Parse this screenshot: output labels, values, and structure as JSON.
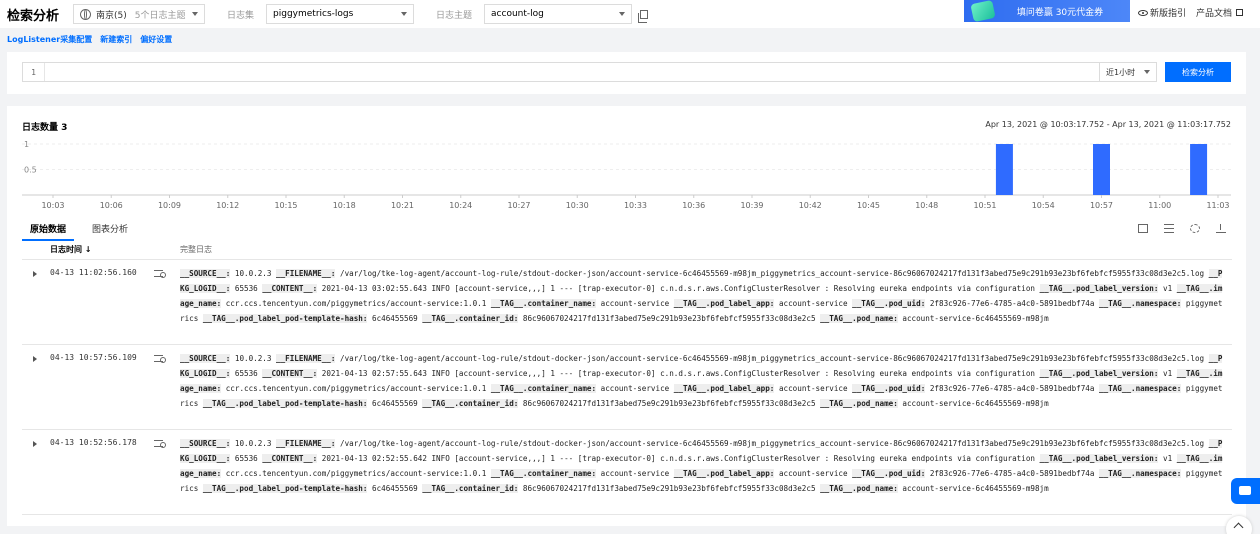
{
  "header": {
    "title": "检索分析",
    "region": "南京(5)",
    "region_sub": "5个日志主题",
    "logset_label": "日志集",
    "logset_value": "piggymetrics-logs",
    "topic_label": "日志主题",
    "topic_value": "account-log",
    "banner": "填问卷赢 30元代金券",
    "guide": "新版指引",
    "docs": "产品文档"
  },
  "links": [
    "LogListener采集配置",
    "新建索引",
    "偏好设置"
  ],
  "search": {
    "line_number": "1",
    "time_range": "近1小时",
    "button": "检索分析"
  },
  "summary": {
    "count_label": "日志数量 3",
    "range": "Apr 13, 2021 @ 10:03:17.752 - Apr 13, 2021 @ 11:03:17.752"
  },
  "chart_data": {
    "type": "bar",
    "ylim": [
      0,
      1
    ],
    "yticks": [
      "1",
      "0.5"
    ],
    "xticks": [
      "10:03",
      "10:06",
      "10:09",
      "10:12",
      "10:15",
      "10:18",
      "10:21",
      "10:24",
      "10:27",
      "10:30",
      "10:33",
      "10:36",
      "10:39",
      "10:42",
      "10:45",
      "10:48",
      "10:51",
      "10:54",
      "10:57",
      "11:00",
      "11:03"
    ],
    "bars": [
      {
        "x": "10:52",
        "value": 1
      },
      {
        "x": "10:57",
        "value": 1
      },
      {
        "x": "11:02",
        "value": 1
      }
    ],
    "color": "#2f6bff"
  },
  "tabs": [
    "原始数据",
    "图表分析"
  ],
  "table": {
    "col_time": "日志时间 ↓",
    "col_log": "完整日志",
    "rows": [
      {
        "time": "04-13 11:02:56.160",
        "parts": [
          {
            "k": "__SOURCE__:",
            "v": " 10.0.2.3 "
          },
          {
            "k": "__FILENAME__:",
            "v": " /var/log/tke-log-agent/account-log-rule/stdout-docker-json/account-service-6c46455569-m98jm_piggymetrics_account-service-86c96067024217fd131f3abed75e9c291b93e23bf6febfcf5955f33c08d3e2c5.log "
          },
          {
            "k": "__PKG_LOGID__:",
            "v": " 65536 "
          },
          {
            "k": "__CONTENT__:",
            "v": " 2021-04-13 03:02:55.643  INFO [account-service,,,] 1 --- [trap-executor-0] c.n.d.s.r.aws.ConfigClusterResolver      : Resolving eureka endpoints via configuration "
          },
          {
            "k": "__TAG__.pod_label_version:",
            "v": " v1 "
          },
          {
            "k": "__TAG__.image_name:",
            "v": " ccr.ccs.tencentyun.com/piggymetrics/account-service:1.0.1 "
          },
          {
            "k": "__TAG__.container_name:",
            "v": " account-service "
          },
          {
            "k": "__TAG__.pod_label_app:",
            "v": " account-service "
          },
          {
            "k": "__TAG__.pod_uid:",
            "v": " 2f83c926-77e6-4785-a4c0-5891bedbf74a "
          },
          {
            "k": "__TAG__.namespace:",
            "v": " piggymetrics "
          },
          {
            "k": "__TAG__.pod_label_pod-template-hash:",
            "v": " 6c46455569 "
          },
          {
            "k": "__TAG__.container_id:",
            "v": " 86c96067024217fd131f3abed75e9c291b93e23bf6febfcf5955f33c08d3e2c5 "
          },
          {
            "k": "__TAG__.pod_name:",
            "v": " account-service-6c46455569-m98jm"
          }
        ]
      },
      {
        "time": "04-13 10:57:56.109",
        "parts": [
          {
            "k": "__SOURCE__:",
            "v": " 10.0.2.3 "
          },
          {
            "k": "__FILENAME__:",
            "v": " /var/log/tke-log-agent/account-log-rule/stdout-docker-json/account-service-6c46455569-m98jm_piggymetrics_account-service-86c96067024217fd131f3abed75e9c291b93e23bf6febfcf5955f33c08d3e2c5.log "
          },
          {
            "k": "__PKG_LOGID__:",
            "v": " 65536 "
          },
          {
            "k": "__CONTENT__:",
            "v": " 2021-04-13 02:57:55.643  INFO [account-service,,,] 1 --- [trap-executor-0] c.n.d.s.r.aws.ConfigClusterResolver      : Resolving eureka endpoints via configuration "
          },
          {
            "k": "__TAG__.pod_label_version:",
            "v": " v1 "
          },
          {
            "k": "__TAG__.image_name:",
            "v": " ccr.ccs.tencentyun.com/piggymetrics/account-service:1.0.1 "
          },
          {
            "k": "__TAG__.container_name:",
            "v": " account-service "
          },
          {
            "k": "__TAG__.pod_label_app:",
            "v": " account-service "
          },
          {
            "k": "__TAG__.pod_uid:",
            "v": " 2f83c926-77e6-4785-a4c0-5891bedbf74a "
          },
          {
            "k": "__TAG__.namespace:",
            "v": " piggymetrics "
          },
          {
            "k": "__TAG__.pod_label_pod-template-hash:",
            "v": " 6c46455569 "
          },
          {
            "k": "__TAG__.container_id:",
            "v": " 86c96067024217fd131f3abed75e9c291b93e23bf6febfcf5955f33c08d3e2c5 "
          },
          {
            "k": "__TAG__.pod_name:",
            "v": " account-service-6c46455569-m98jm"
          }
        ]
      },
      {
        "time": "04-13 10:52:56.178",
        "parts": [
          {
            "k": "__SOURCE__:",
            "v": " 10.0.2.3 "
          },
          {
            "k": "__FILENAME__:",
            "v": " /var/log/tke-log-agent/account-log-rule/stdout-docker-json/account-service-6c46455569-m98jm_piggymetrics_account-service-86c96067024217fd131f3abed75e9c291b93e23bf6febfcf5955f33c08d3e2c5.log "
          },
          {
            "k": "__PKG_LOGID__:",
            "v": " 65536 "
          },
          {
            "k": "__CONTENT__:",
            "v": " 2021-04-13 02:52:55.642  INFO [account-service,,,] 1 --- [trap-executor-0] c.n.d.s.r.aws.ConfigClusterResolver      : Resolving eureka endpoints via configuration "
          },
          {
            "k": "__TAG__.pod_label_version:",
            "v": " v1 "
          },
          {
            "k": "__TAG__.image_name:",
            "v": " ccr.ccs.tencentyun.com/piggymetrics/account-service:1.0.1 "
          },
          {
            "k": "__TAG__.container_name:",
            "v": " account-service "
          },
          {
            "k": "__TAG__.pod_label_app:",
            "v": " account-service "
          },
          {
            "k": "__TAG__.pod_uid:",
            "v": " 2f83c926-77e6-4785-a4c0-5891bedbf74a "
          },
          {
            "k": "__TAG__.namespace:",
            "v": " piggymetrics "
          },
          {
            "k": "__TAG__.pod_label_pod-template-hash:",
            "v": " 6c46455569 "
          },
          {
            "k": "__TAG__.container_id:",
            "v": " 86c96067024217fd131f3abed75e9c291b93e23bf6febfcf5955f33c08d3e2c5 "
          },
          {
            "k": "__TAG__.pod_name:",
            "v": " account-service-6c46455569-m98jm"
          }
        ]
      }
    ]
  }
}
